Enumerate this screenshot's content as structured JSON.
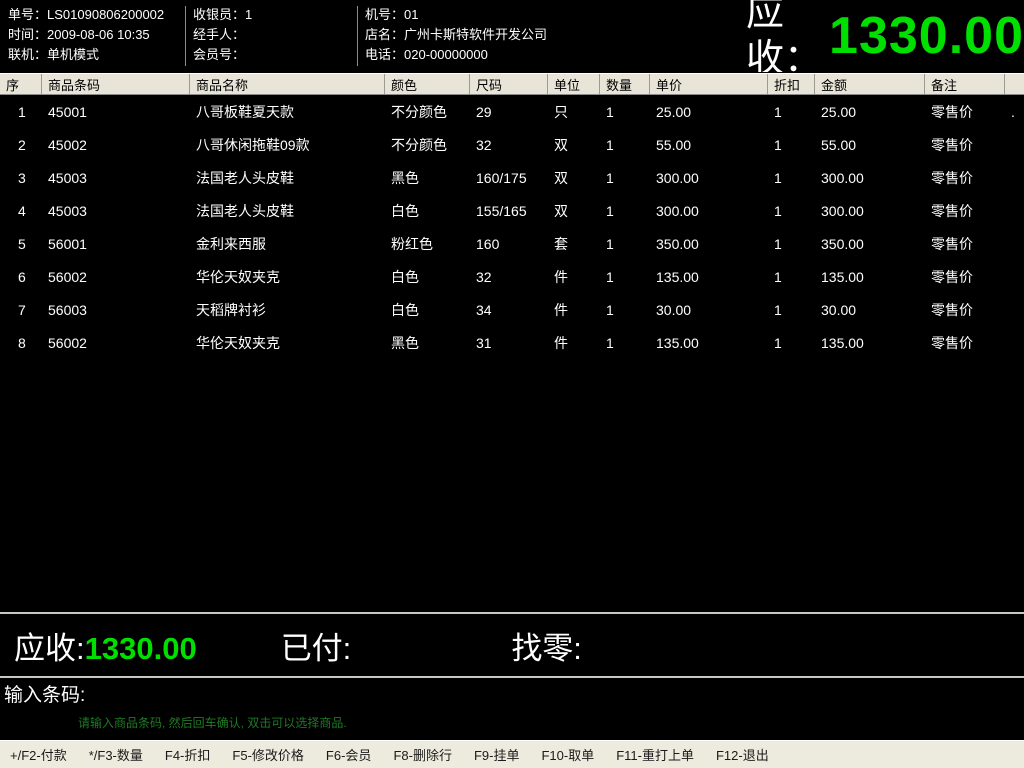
{
  "header": {
    "panel_order": {
      "label": "单号：",
      "value": "LS01090806200002"
    },
    "panel_time": {
      "label": "时间：",
      "value": "2009-08-06  10:35"
    },
    "panel_link": {
      "label": "联机：",
      "value": "单机模式"
    },
    "panel_cashier": {
      "label": "收银员：",
      "value": "1"
    },
    "panel_handler": {
      "label": "经手人：",
      "value": ""
    },
    "panel_member": {
      "label": "会员号：",
      "value": ""
    },
    "panel_machine": {
      "label": "机号：",
      "value": "01"
    },
    "panel_shop": {
      "label": "店名：",
      "value": "广州卡斯特软件开发公司"
    },
    "panel_phone": {
      "label": "电话：",
      "value": "020-00000000"
    },
    "total": {
      "label": "应收：",
      "value": "1330.00",
      "color": "#00e000"
    }
  },
  "grid": {
    "columns": [
      "序",
      "商品条码",
      "商品名称",
      "颜色",
      "尺码",
      "单位",
      "数量",
      "单价",
      "折扣",
      "金额",
      "备注",
      ""
    ],
    "rows": [
      {
        "idx": "1",
        "code": "45001",
        "name": "八哥板鞋夏天款",
        "color": "不分颜色",
        "size": "29",
        "unit": "只",
        "qty": "1",
        "price": "25.00",
        "discount": "1",
        "amount": "25.00",
        "note": "零售价",
        "tail": "."
      },
      {
        "idx": "2",
        "code": "45002",
        "name": "八哥休闲拖鞋09款",
        "color": "不分颜色",
        "size": "32",
        "unit": "双",
        "qty": "1",
        "price": "55.00",
        "discount": "1",
        "amount": "55.00",
        "note": "零售价",
        "tail": ""
      },
      {
        "idx": "3",
        "code": "45003",
        "name": "法国老人头皮鞋",
        "color": "黑色",
        "size": "160/175",
        "unit": "双",
        "qty": "1",
        "price": "300.00",
        "discount": "1",
        "amount": "300.00",
        "note": "零售价",
        "tail": ""
      },
      {
        "idx": "4",
        "code": "45003",
        "name": "法国老人头皮鞋",
        "color": "白色",
        "size": "155/165",
        "unit": "双",
        "qty": "1",
        "price": "300.00",
        "discount": "1",
        "amount": "300.00",
        "note": "零售价",
        "tail": ""
      },
      {
        "idx": "5",
        "code": "56001",
        "name": "金利来西服",
        "color": "粉红色",
        "size": "160",
        "unit": "套",
        "qty": "1",
        "price": "350.00",
        "discount": "1",
        "amount": "350.00",
        "note": "零售价",
        "tail": ""
      },
      {
        "idx": "6",
        "code": "56002",
        "name": "华伦天奴夹克",
        "color": "白色",
        "size": "32",
        "unit": "件",
        "qty": "1",
        "price": "135.00",
        "discount": "1",
        "amount": "135.00",
        "note": "零售价",
        "tail": ""
      },
      {
        "idx": "7",
        "code": "56003",
        "name": "天稻牌衬衫",
        "color": "白色",
        "size": "34",
        "unit": "件",
        "qty": "1",
        "price": "30.00",
        "discount": "1",
        "amount": "30.00",
        "note": "零售价",
        "tail": ""
      },
      {
        "idx": "8",
        "code": "56002",
        "name": "华伦天奴夹克",
        "color": "黑色",
        "size": "31",
        "unit": "件",
        "qty": "1",
        "price": "135.00",
        "discount": "1",
        "amount": "135.00",
        "note": "零售价",
        "tail": ""
      }
    ]
  },
  "summary": {
    "receivable_label": "应收:",
    "receivable_value": "1330.00",
    "paid_label": "已付:",
    "paid_value": "",
    "change_label": "找零:",
    "change_value": ""
  },
  "input": {
    "label": "输入条码:",
    "value": "",
    "placeholder": "",
    "hint": "请输入商品条码, 然后回车确认, 双击可以选择商品."
  },
  "function_keys": [
    "+/F2-付款",
    "*/F3-数量",
    "F4-折扣",
    "F5-修改价格",
    "F6-会员",
    "F8-删除行",
    "F9-挂单",
    "F10-取单",
    "F11-重打上单",
    "F12-退出"
  ]
}
